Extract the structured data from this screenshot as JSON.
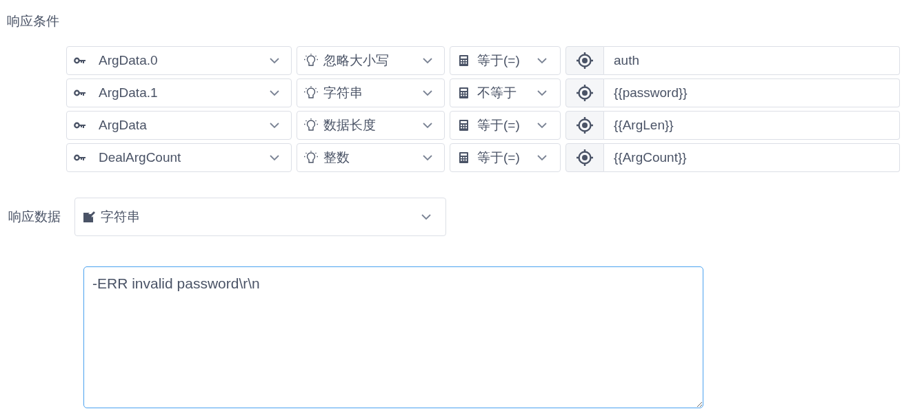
{
  "conditions_label": "响应条件",
  "conditions": [
    {
      "field": "ArgData.0",
      "match_type": "忽略大小写",
      "operator": "等于(=)",
      "value": "auth"
    },
    {
      "field": "ArgData.1",
      "match_type": "字符串",
      "operator": "不等于",
      "value": "{{password}}"
    },
    {
      "field": "ArgData",
      "match_type": "数据长度",
      "operator": "等于(=)",
      "value": "{{ArgLen}}"
    },
    {
      "field": "DealArgCount",
      "match_type": "整数",
      "operator": "等于(=)",
      "value": "{{ArgCount}}"
    }
  ],
  "response_label": "响应数据",
  "response_type": "字符串",
  "response_body": "-ERR invalid password\\r\\n"
}
